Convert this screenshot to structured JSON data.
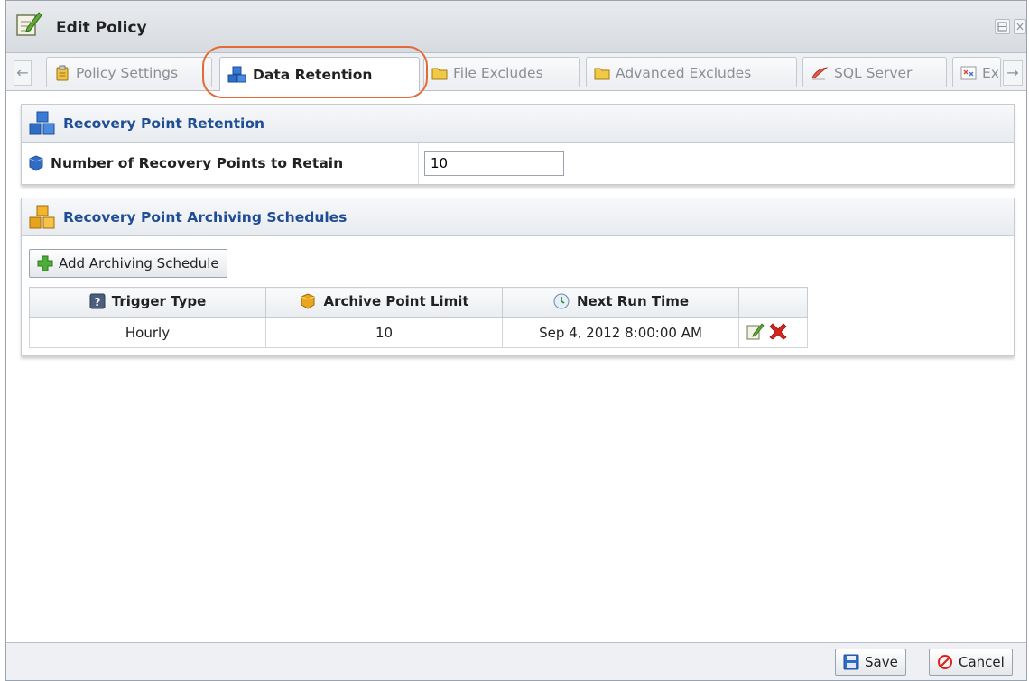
{
  "window": {
    "title": "Edit Policy"
  },
  "tabs": [
    {
      "label": "Policy Settings",
      "icon": "clipboard-icon",
      "active": false
    },
    {
      "label": "Data Retention",
      "icon": "blue-cubes-icon",
      "active": true
    },
    {
      "label": "File Excludes",
      "icon": "folder-icon",
      "active": false
    },
    {
      "label": "Advanced Excludes",
      "icon": "folder-icon",
      "active": false
    },
    {
      "label": "SQL Server",
      "icon": "sql-server-icon",
      "active": false
    },
    {
      "label": "Ex",
      "icon": "exchange-icon",
      "active": false
    }
  ],
  "retention": {
    "header": "Recovery Point Retention",
    "field_label": "Number of Recovery Points to Retain",
    "field_value": "10"
  },
  "archiving": {
    "header": "Recovery Point Archiving Schedules",
    "add_button": "Add Archiving Schedule",
    "columns": [
      "Trigger Type",
      "Archive Point Limit",
      "Next Run Time",
      ""
    ],
    "rows": [
      {
        "trigger_type": "Hourly",
        "archive_point_limit": "10",
        "next_run_time": "Sep 4, 2012 8:00:00 AM"
      }
    ]
  },
  "footer": {
    "save_label": "Save",
    "cancel_label": "Cancel"
  },
  "colors": {
    "header_text": "#1f4e94",
    "highlight": "#e36a37",
    "delete_red": "#d9241b"
  }
}
